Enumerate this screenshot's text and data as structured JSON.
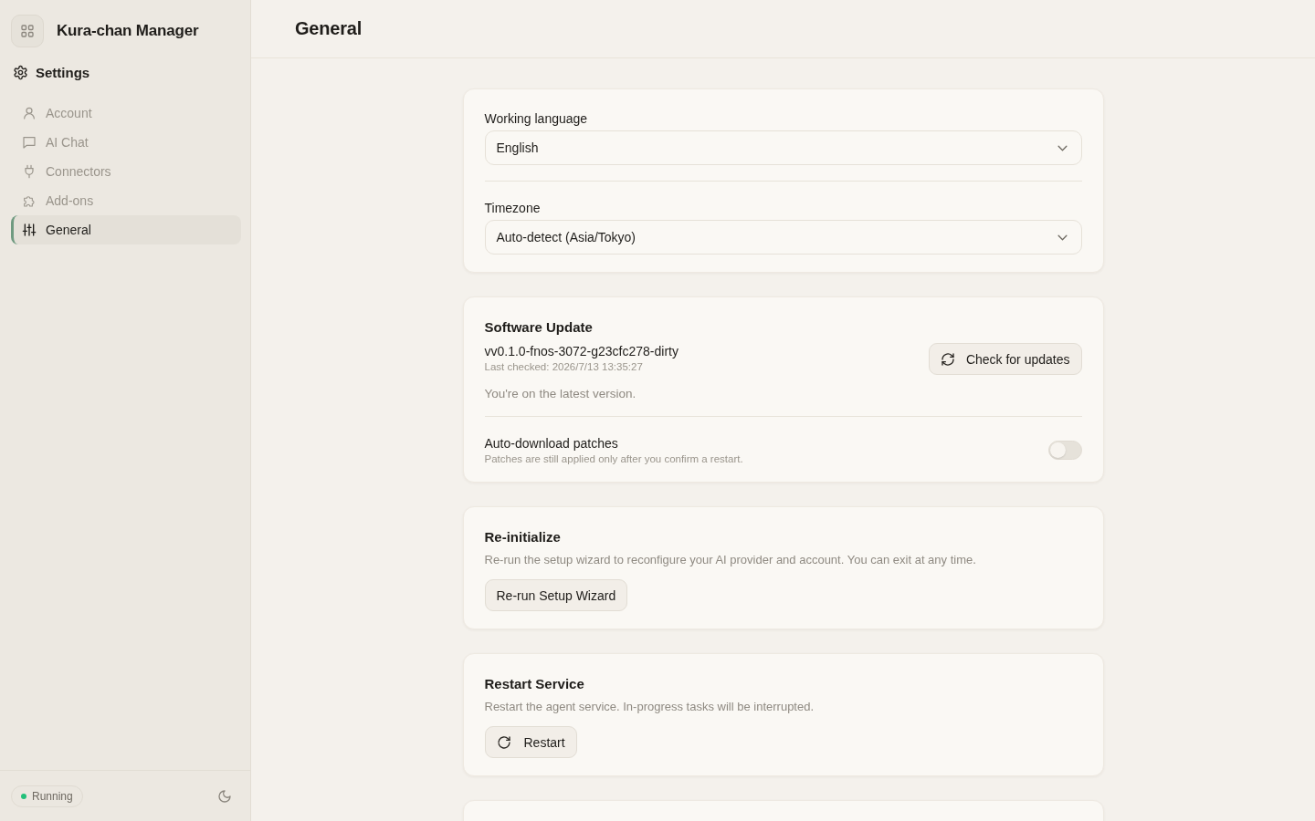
{
  "sidebar": {
    "app_title": "Kura-chan Manager",
    "section_title": "Settings",
    "items": [
      {
        "label": "Account",
        "selected": false
      },
      {
        "label": "AI Chat",
        "selected": false
      },
      {
        "label": "Connectors",
        "selected": false
      },
      {
        "label": "Add-ons",
        "selected": false
      },
      {
        "label": "General",
        "selected": true
      }
    ],
    "status": {
      "label": "Running",
      "color": "#22c07a"
    }
  },
  "header": {
    "title": "General"
  },
  "preferences": {
    "language": {
      "label": "Working language",
      "value": "English"
    },
    "timezone": {
      "label": "Timezone",
      "value": "Auto-detect (Asia/Tokyo)"
    }
  },
  "software_update": {
    "title": "Software Update",
    "version": "vv0.1.0-fnos-3072-g23cfc278-dirty",
    "last_checked": "Last checked: 2026/7/13 13:35:27",
    "message": "You're on the latest version.",
    "button": "Check for updates",
    "auto_download": {
      "label": "Auto-download patches",
      "hint": "Patches are still applied only after you confirm a restart.",
      "on": false
    }
  },
  "reinitialize": {
    "title": "Re-initialize",
    "description": "Re-run the setup wizard to reconfigure your AI provider and account. You can exit at any time.",
    "button": "Re-run Setup Wizard"
  },
  "restart_service": {
    "title": "Restart Service",
    "description": "Restart the agent service. In-progress tasks will be interrupted.",
    "button": "Restart"
  }
}
